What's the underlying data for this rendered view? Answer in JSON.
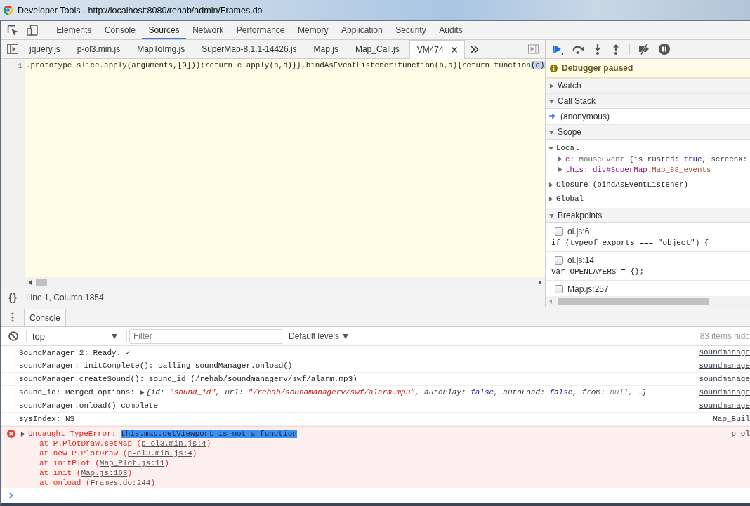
{
  "window": {
    "title": "Developer Tools - http://localhost:8080/rehab/admin/Frames.do"
  },
  "main_tabs": [
    {
      "label": "Elements",
      "selected": false
    },
    {
      "label": "Console",
      "selected": false
    },
    {
      "label": "Sources",
      "selected": true
    },
    {
      "label": "Network",
      "selected": false
    },
    {
      "label": "Performance",
      "selected": false
    },
    {
      "label": "Memory",
      "selected": false
    },
    {
      "label": "Application",
      "selected": false
    },
    {
      "label": "Security",
      "selected": false
    },
    {
      "label": "Audits",
      "selected": false
    }
  ],
  "file_tabs": [
    {
      "label": "jquery.js",
      "selected": false
    },
    {
      "label": "p-ol3.min.js",
      "selected": false
    },
    {
      "label": "MapToImg.js",
      "selected": false
    },
    {
      "label": "SuperMap-8.1.1-14426.js",
      "selected": false
    },
    {
      "label": "Map.js",
      "selected": false
    },
    {
      "label": "Map_Call.js",
      "selected": false
    },
    {
      "label": "VM474",
      "selected": true
    }
  ],
  "editor": {
    "line_number": "1",
    "code": ".prototype.slice.apply(arguments,[0]));return c.apply(b,d)}},bindAsEventListener:function(b,a){return function",
    "execution_point": "(c)"
  },
  "status_bar": {
    "format_button": "{}",
    "position": "Line 1, Column 1854"
  },
  "debugger": {
    "banner": "Debugger paused",
    "sections": [
      {
        "title": "Watch",
        "expanded": false
      },
      {
        "title": "Call Stack",
        "expanded": true,
        "frames": [
          {
            "label": "(anonymous)",
            "selected": true
          }
        ]
      },
      {
        "title": "Scope",
        "expanded": true,
        "scopes": [
          {
            "label": "Local",
            "expanded": true,
            "children": [
              {
                "expanded": false,
                "tokens": [
                  {
                    "kind": "name",
                    "text": "c"
                  },
                  {
                    "kind": "punct",
                    "text": ": "
                  },
                  {
                    "kind": "class",
                    "text": "MouseEvent "
                  },
                  {
                    "kind": "punct",
                    "text": "{isTrusted: "
                  },
                  {
                    "kind": "keyword",
                    "text": "true"
                  },
                  {
                    "kind": "punct",
                    "text": ", screenX:"
                  }
                ]
              },
              {
                "expanded": false,
                "tokens": [
                  {
                    "kind": "name",
                    "text": "this"
                  },
                  {
                    "kind": "punct",
                    "text": ": "
                  },
                  {
                    "kind": "tag",
                    "text": "div#SuperMap"
                  },
                  {
                    "kind": "css_class",
                    "text": ".Map_88_events"
                  }
                ]
              }
            ]
          },
          {
            "label": "Closure (bindAsEventListener)",
            "expanded": false
          },
          {
            "label": "Global",
            "expanded": false
          }
        ]
      },
      {
        "title": "Breakpoints",
        "expanded": true,
        "breakpoints": [
          {
            "location": "ol.js:6",
            "code": "if (typeof exports === \"object\") {",
            "checked": false
          },
          {
            "location": "ol.js:14",
            "code": "var OPENLAYERS = {};",
            "checked": false
          },
          {
            "location": "Map.js:257",
            "checked": false
          }
        ]
      }
    ]
  },
  "drawer": {
    "tabs": [
      {
        "label": "Console",
        "selected": true
      }
    ]
  },
  "console": {
    "context": "top",
    "filter_placeholder": "Filter",
    "levels": "Default levels",
    "hidden_count": "83 items hidd",
    "messages": [
      {
        "kind": "log",
        "text": "SoundManager 2: Ready. ✓",
        "source": "soundmanage"
      },
      {
        "kind": "log",
        "text": "soundManager: initComplete(): calling soundManager.onload()",
        "source": "soundmanage"
      },
      {
        "kind": "log",
        "text": "soundManager.createSound(): sound_id (/rehab/soundmanagerv/swf/alarm.mp3)",
        "source": "soundmanage"
      },
      {
        "kind": "log",
        "text": "sound_id: Merged options:",
        "object_preview": {
          "expanded": false,
          "tokens": [
            {
              "kind": "punct",
              "text": "{id: "
            },
            {
              "kind": "string",
              "text": "\"sound_id\""
            },
            {
              "kind": "punct",
              "text": ", url: "
            },
            {
              "kind": "string",
              "text": "\"/rehab/soundmanagerv/swf/alarm.mp3\""
            },
            {
              "kind": "punct",
              "text": ", autoPlay: "
            },
            {
              "kind": "keyword",
              "text": "false"
            },
            {
              "kind": "punct",
              "text": ", autoLoad: "
            },
            {
              "kind": "keyword",
              "text": "false"
            },
            {
              "kind": "punct",
              "text": ", from: "
            },
            {
              "kind": "null",
              "text": "null"
            },
            {
              "kind": "punct",
              "text": ", …}"
            }
          ]
        },
        "source": "soundmanage"
      },
      {
        "kind": "log",
        "text": "soundManager.onload() complete",
        "source": "soundmanage"
      },
      {
        "kind": "log",
        "text": "sysIndex: NS",
        "source": "Map_Buil"
      },
      {
        "kind": "error",
        "expanded": false,
        "text": "Uncaught TypeError: ",
        "selection": "this.map.getViewport is not a function",
        "source": "p-ol",
        "stack": [
          {
            "prefix": "at P.PlotDraw.setMap (",
            "link": "p-ol3.min.js:4",
            "suffix": ")"
          },
          {
            "prefix": "at new P.PlotDraw (",
            "link": "p-ol3.min.js:4",
            "suffix": ")"
          },
          {
            "prefix": "at initPlot (",
            "link": "Map_Plot.js:11",
            "suffix": ")"
          },
          {
            "prefix": "at init (",
            "link": "Map.js:163",
            "suffix": ")"
          },
          {
            "prefix": "at onload (",
            "link": "Frames.do:244",
            "suffix": ")"
          }
        ]
      }
    ]
  }
}
